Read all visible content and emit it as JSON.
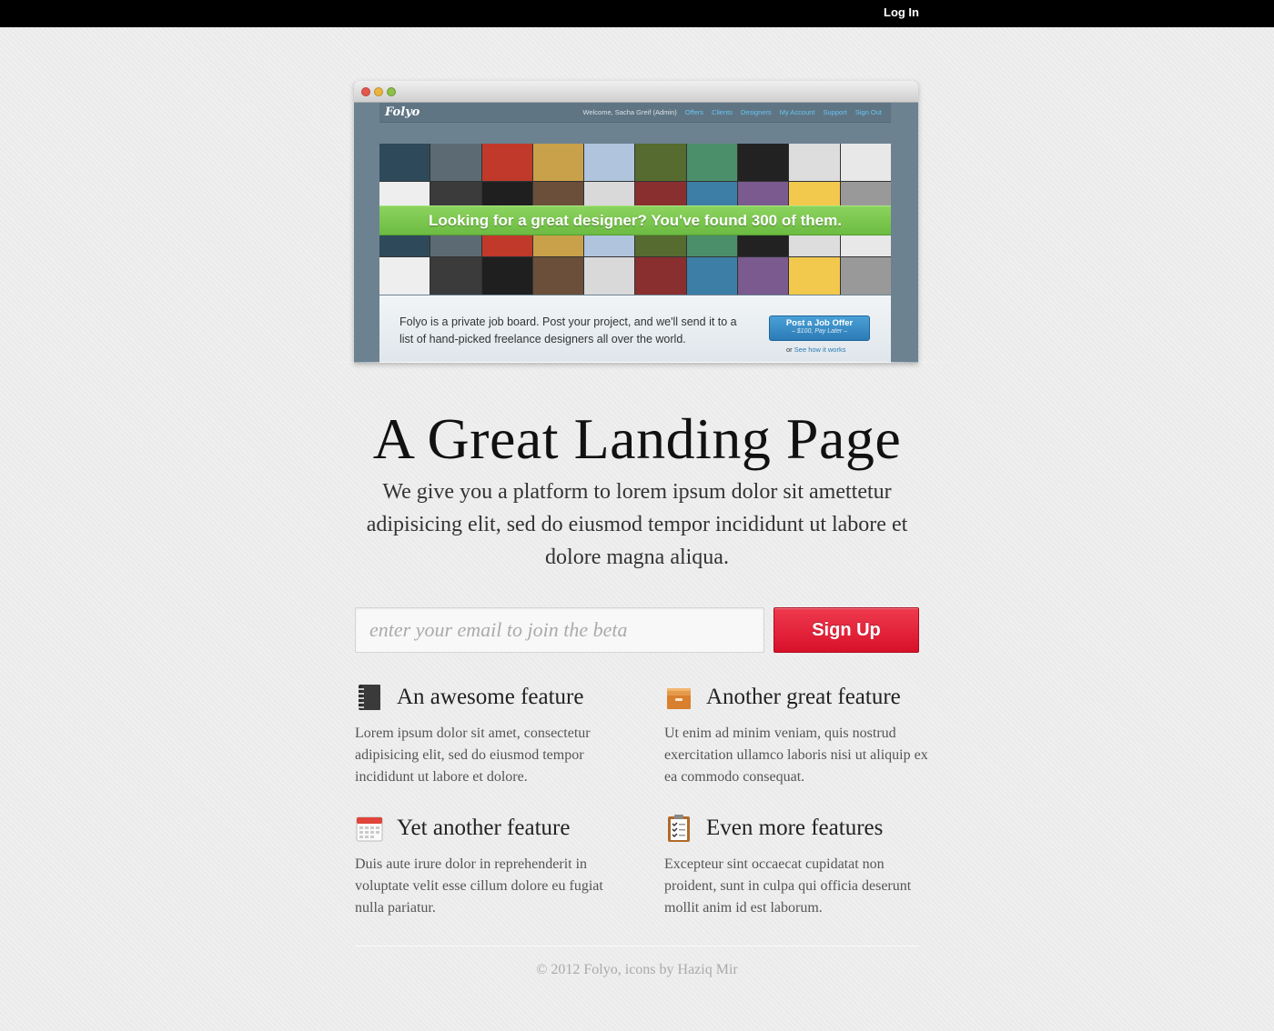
{
  "topbar": {
    "login_label": "Log In"
  },
  "screenshot": {
    "site": {
      "logo": "Folyo",
      "nav": {
        "welcome": "Welcome, Sacha Greif (Admin)",
        "links": [
          "Offers",
          "Clients",
          "Designers",
          "My Account",
          "Support",
          "Sign Out"
        ]
      },
      "banner": "Looking for a great designer? You've found 300 of them.",
      "description": "Folyo is a private job board. Post your project, and we'll send it to a list of hand-picked freelance designers all over the world.",
      "cta": {
        "label": "Post a Job Offer",
        "sub": "– $100, Pay Later –"
      },
      "see_how": {
        "prefix": "or",
        "link": "See how it works"
      }
    }
  },
  "hero": {
    "title": "A Great Landing Page",
    "subtitle": "We give you a platform to lorem ipsum dolor sit amettetur adipisicing elit, sed do eiusmod tempor incididunt ut labore et dolore magna aliqua."
  },
  "signup": {
    "placeholder": "enter your email to join the beta",
    "button_label": "Sign Up"
  },
  "features": [
    {
      "icon": "notebook-icon",
      "title": "An awesome feature",
      "text": "Lorem ipsum dolor sit amet, consectetur adipisicing elit, sed do eiusmod tempor incididunt ut labore et dolore."
    },
    {
      "icon": "archive-box-icon",
      "title": "Another great feature",
      "text": "Ut enim ad minim veniam, quis nostrud exercitation ullamco laboris nisi ut aliquip ex ea commodo consequat."
    },
    {
      "icon": "calendar-icon",
      "title": "Yet another feature",
      "text": "Duis aute irure dolor in reprehenderit in voluptate velit esse cillum dolore eu fugiat nulla pariatur."
    },
    {
      "icon": "clipboard-checklist-icon",
      "title": "Even more features",
      "text": "Excepteur sint occaecat cupidatat non proident, sunt in culpa qui officia deserunt mollit anim id est laborum."
    }
  ],
  "footer": {
    "text": "© 2012 Folyo, icons by Haziq Mir"
  },
  "colors": {
    "accent": "#d8102a",
    "topbar": "#000000",
    "banner_green": "#7ac84f",
    "cta_blue": "#2c7bb6"
  }
}
